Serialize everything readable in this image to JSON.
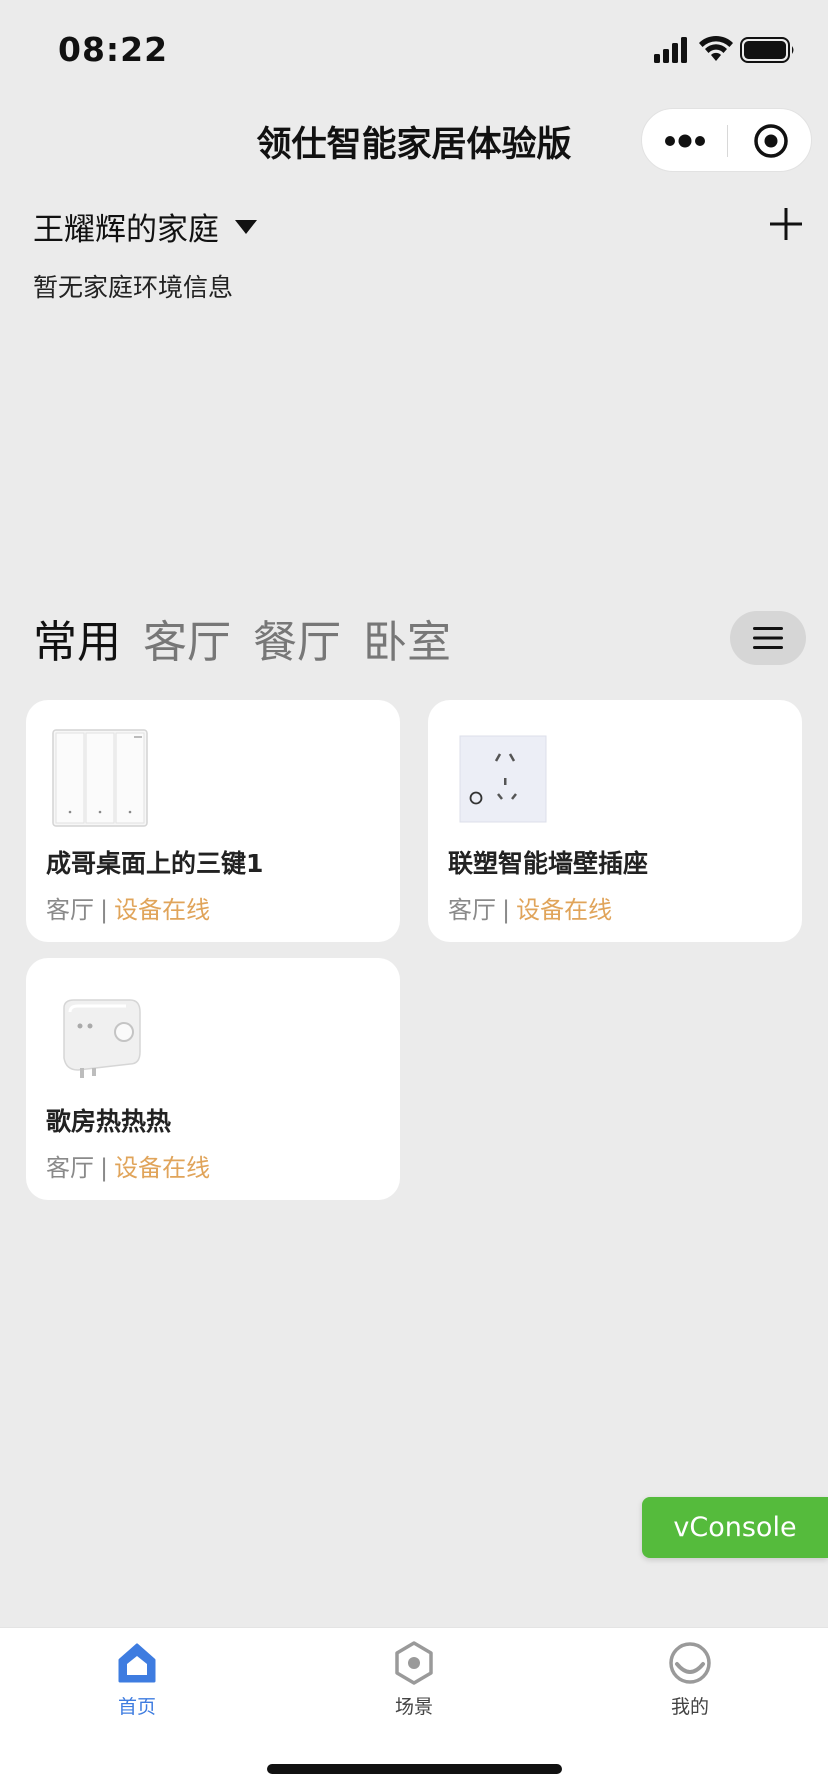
{
  "status_bar": {
    "time": "08:22"
  },
  "nav": {
    "title": "领仕智能家居体验版"
  },
  "home": {
    "name": "王耀辉的家庭",
    "env_info": "暂无家庭环境信息"
  },
  "tabs": [
    {
      "label": "常用",
      "active": true
    },
    {
      "label": "客厅",
      "active": false
    },
    {
      "label": "餐厅",
      "active": false
    },
    {
      "label": "卧室",
      "active": false
    }
  ],
  "devices": [
    {
      "name": "成哥桌面上的三键1",
      "room": "客厅",
      "status": "设备在线",
      "icon": "three-key-switch-image"
    },
    {
      "name": "联塑智能墙壁插座",
      "room": "客厅",
      "status": "设备在线",
      "icon": "wall-socket-image"
    },
    {
      "name": "歌房热热热",
      "room": "客厅",
      "status": "设备在线",
      "icon": "smart-plug-image"
    }
  ],
  "vconsole": {
    "label": "vConsole"
  },
  "tabbar": {
    "items": [
      {
        "label": "首页",
        "icon": "home-icon",
        "active": true
      },
      {
        "label": "场景",
        "icon": "scene-icon",
        "active": false
      },
      {
        "label": "我的",
        "icon": "profile-icon",
        "active": false
      }
    ]
  },
  "colors": {
    "accent": "#3e7ce0",
    "status_online": "#e0a45a",
    "vconsole": "#55bb3c",
    "background": "#ebebeb"
  }
}
